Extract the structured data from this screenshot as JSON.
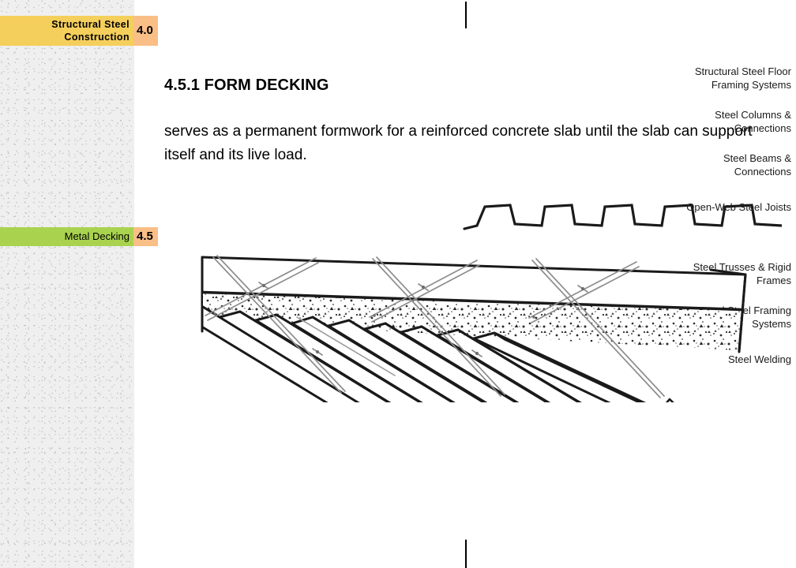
{
  "sidebar": {
    "chapter": {
      "label": "Structural Steel Construction",
      "number": "4.0"
    },
    "items": [
      {
        "label": "Structural Steel Floor Framing Systems"
      },
      {
        "label": "Steel Columns & Connections"
      },
      {
        "label": "Steel Beams & Connections"
      },
      {
        "label": "Open-Web Steel Joists"
      },
      {
        "label": "Steel Trusses & Rigid Frames"
      },
      {
        "label": "Structural Steel Framing Systems"
      },
      {
        "label": "Steel Welding"
      }
    ],
    "active_section": {
      "label": "Metal Decking",
      "number": "4.5"
    },
    "colors": {
      "chapter_band": "#f5cf5c",
      "section_band": "#a9d34e",
      "number_box": "#f9bf87",
      "background": "#efefef"
    }
  },
  "main": {
    "heading": "4.5.1 FORM DECKING",
    "body": "serves as a permanent formwork for a reinforced concrete slab until the slab can support itself and its live load."
  },
  "figure": {
    "caption": "",
    "description": "Cutaway perspective of a reinforced concrete slab cast on corrugated steel form decking with welded wire mesh reinforcement, and a detached corrugated deck profile at upper right",
    "ink_color": "#1a1a1a"
  },
  "marks": {
    "top": "crop-mark",
    "bottom": "crop-mark"
  }
}
